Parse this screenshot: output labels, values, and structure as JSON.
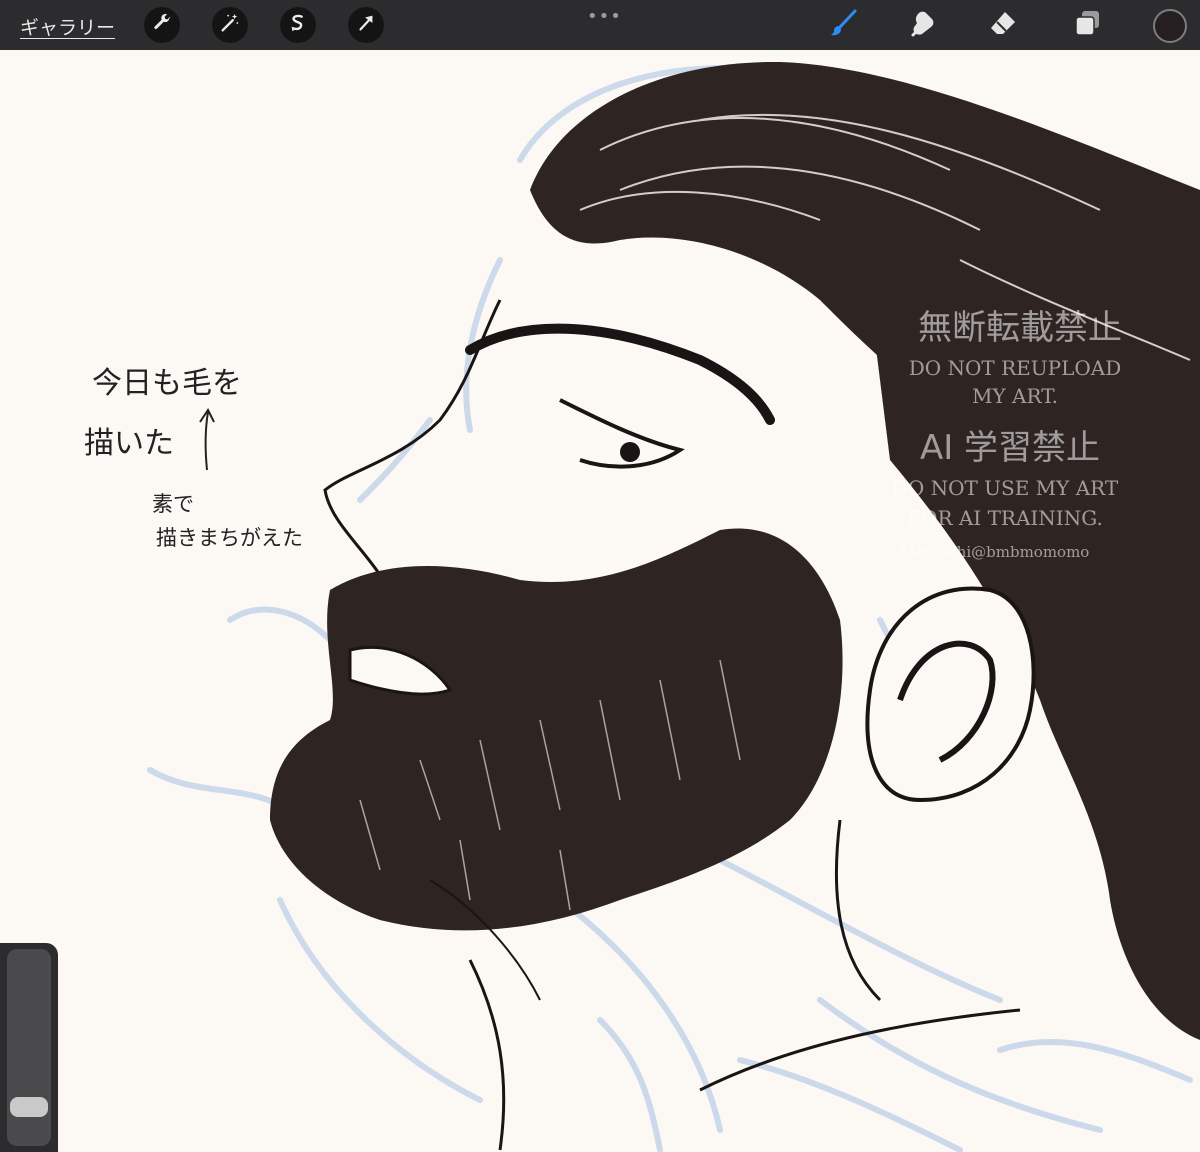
{
  "toolbar": {
    "gallery_label": "ギャラリー",
    "left_tools": [
      "wrench-icon",
      "magic-wand-icon",
      "selection-icon",
      "transform-arrow-icon"
    ],
    "right_tools": [
      "brush-icon",
      "smudge-icon",
      "eraser-icon",
      "layers-icon"
    ],
    "active_tool": "brush-icon",
    "accent_color": "#2b8df5",
    "current_color": "#261f22"
  },
  "slider": {
    "level": 0.15
  },
  "notes": {
    "line1": "今日も毛を",
    "line2": "描いた",
    "line3": "素で",
    "line4": "描きまちがえた"
  },
  "watermark": {
    "jp1": "無断転載禁止",
    "en1": "DO NOT REUPLOAD",
    "en2": "MY ART.",
    "jp2": "AI 学習禁止",
    "en3": "DO NOT USE MY ART",
    "en4": "FOR AI TRAINING.",
    "handle": "Momochi@bmbmomomo"
  }
}
